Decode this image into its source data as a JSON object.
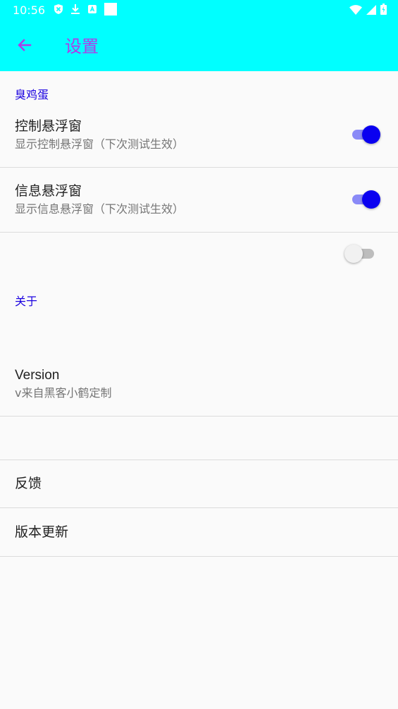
{
  "status_bar": {
    "time": "10:56",
    "left_icons": [
      "shield-x-icon",
      "download-icon",
      "app-a-icon",
      "square-icon"
    ],
    "right_icons": [
      "wifi-icon",
      "signal-icon",
      "battery-icon"
    ]
  },
  "app_bar": {
    "title": "设置",
    "back_icon": "arrow-left-icon",
    "background": "#00ffff",
    "title_color": "#b03ae8"
  },
  "categories": {
    "first": "臭鸡蛋",
    "second": "关于"
  },
  "prefs": {
    "control_float": {
      "title": "控制悬浮窗",
      "summary": "显示控制悬浮窗（下次测试生效）",
      "checked": true
    },
    "info_float": {
      "title": "信息悬浮窗",
      "summary": "显示信息悬浮窗（下次测试生效）",
      "checked": true
    },
    "unlabeled_switch": {
      "checked": false
    },
    "version": {
      "title": "Version",
      "summary": "v来自黑客小鹤定制"
    },
    "feedback": {
      "title": "反馈"
    },
    "update": {
      "title": "版本更新"
    }
  },
  "colors": {
    "accent": "#0a00f0",
    "category_text": "#1a00e0"
  }
}
